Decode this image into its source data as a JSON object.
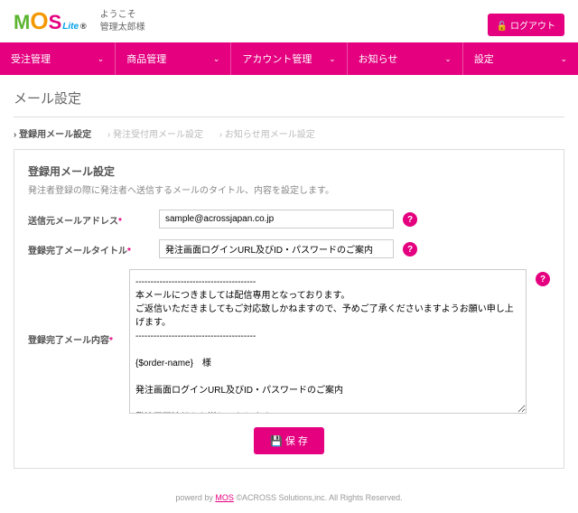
{
  "header": {
    "logo_m": "M",
    "logo_o": "O",
    "logo_s": "S",
    "logo_lite": "Lite",
    "logo_r": "®",
    "welcome_line1": "ようこそ",
    "welcome_line2": "管理太郎様",
    "logout": "ログアウト"
  },
  "nav": {
    "items": [
      "受注管理",
      "商品管理",
      "アカウント管理",
      "お知らせ",
      "設定"
    ]
  },
  "page": {
    "title": "メール設定",
    "tabs": [
      "登録用メール設定",
      "発注受付用メール設定",
      "お知らせ用メール設定"
    ]
  },
  "panel": {
    "title": "登録用メール設定",
    "desc": "発注者登録の際に発注者へ送信するメールのタイトル、内容を設定します。",
    "from_label": "送信元メールアドレス",
    "from_value": "sample@acrossjapan.co.jp",
    "title_label": "登録完了メールタイトル",
    "title_value": "発注画面ログインURL及びID・パスワードのご案内",
    "body_label": "登録完了メール内容",
    "body_value": "----------------------------------------\n本メールにつきましては配信専用となっております。\nご返信いただきましてもご対応致しかねますので、予めご了承くださいますようお願い申し上げます。\n----------------------------------------\n\n{$order-name}　様\n\n発注画面ログインURL及びID・パスワードのご案内\n\n発注画面情報をお送りいたします。\n以下の発注画面URLにアクセスし、ログインIDとパスワードを入力することで発注業務を行うことができます。\n\n【発注画面URL】\n{$login-url}\n\nログインID ： {$login-id}",
    "save": "保 存"
  },
  "footer": {
    "pre": "powerd by ",
    "link": "MOS",
    "post": " ©ACROSS Solutions,inc. All Rights Reserved."
  }
}
